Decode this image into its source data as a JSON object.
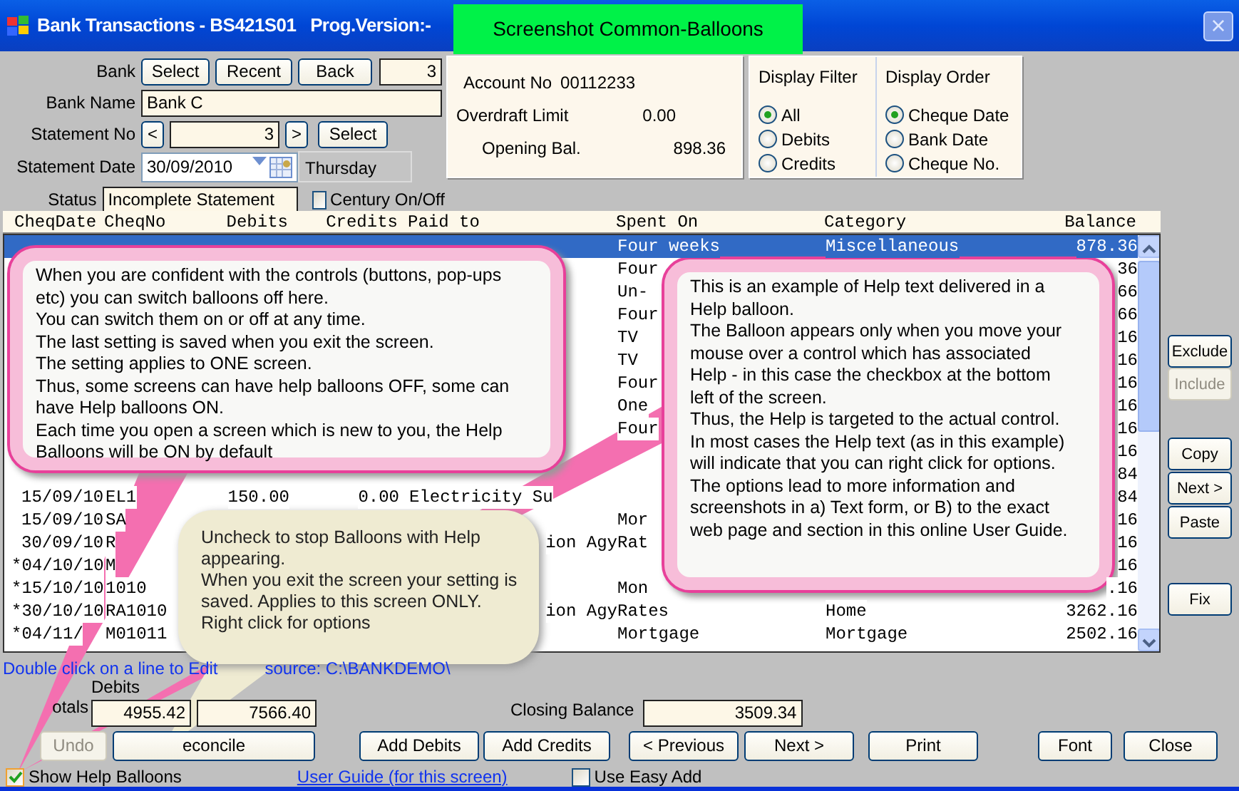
{
  "window": {
    "title": "Bank Transactions - BS421S01   Prog.Version:-",
    "close": "×"
  },
  "screenshot_label": "Screenshot Common-Balloons",
  "bank": {
    "label": "Bank",
    "buttons": [
      "Select",
      "Recent",
      "Back"
    ],
    "value": "3"
  },
  "bank_name": {
    "label": "Bank Name",
    "value": "Bank C"
  },
  "statement_no": {
    "label": "Statement No",
    "prev": "<",
    "value": "3",
    "next": ">",
    "button": "Select"
  },
  "statement_date": {
    "label": "Statement Date",
    "value": "30/09/2010",
    "weekday": "Thursday"
  },
  "status": {
    "label": "Status",
    "value": "Incomplete Statement"
  },
  "century": {
    "label": "Century On/Off",
    "checked": false
  },
  "account": [
    {
      "label": "Account No",
      "value": "00112233"
    },
    {
      "label": "Overdraft Limit",
      "value": "0.00"
    },
    {
      "label": "Opening Bal.",
      "value": "898.36"
    }
  ],
  "display_filter": {
    "title": "Display Filter",
    "options": [
      {
        "label": "All",
        "selected": true
      },
      {
        "label": "Debits",
        "selected": false
      },
      {
        "label": "Credits",
        "selected": false
      }
    ]
  },
  "display_order": {
    "title": "Display Order",
    "options": [
      {
        "label": "Cheque Date",
        "selected": true
      },
      {
        "label": "Bank Date",
        "selected": false
      },
      {
        "label": "Cheque No.",
        "selected": false
      }
    ]
  },
  "table": {
    "columns": [
      "CheqDate",
      "CheqNo",
      "Debits",
      "Credits",
      "Paid to",
      "Spent On",
      "Category",
      "Balance"
    ],
    "rows": [
      {
        "selected": true,
        "spent_on": "Four weeks",
        "category": "Miscellaneous",
        "balance": "878.36"
      },
      {
        "selected": false,
        "spent_on": "Four",
        "balance": "36"
      },
      {
        "selected": false,
        "spent_on": "Un-",
        "balance": "66"
      },
      {
        "selected": false,
        "spent_on": "Four",
        "balance": "66"
      },
      {
        "selected": false,
        "spent_on": "TV",
        "balance": "16"
      },
      {
        "selected": false,
        "spent_on": "TV",
        "balance": "16"
      },
      {
        "selected": false,
        "spent_on": "Four",
        "balance": "16"
      },
      {
        "selected": false,
        "spent_on": "One",
        "balance": "16"
      },
      {
        "selected": false,
        "spent_on": "Four",
        "balance": "16"
      },
      {
        "selected": false,
        "balance": "16"
      },
      {
        "selected": false,
        "balance": "84"
      },
      {
        "selected": false,
        "date": "15/09/10",
        "cheque": "EL1",
        "debits": "150.00",
        "credits": "0.00",
        "paid_to": "Electricity Su",
        "balance": "84"
      },
      {
        "selected": false,
        "date": "15/09/10",
        "cheque": "SA",
        "spent_on": "Mor",
        "balance": "16"
      },
      {
        "selected": false,
        "date": "30/09/10",
        "cheque": "R",
        "paid_to": "ion Agy",
        "paid_to_cut": true,
        "spent_on": "Rat",
        "balance": "16"
      },
      {
        "selected": false,
        "date": "*04/10/10",
        "cheque": "M",
        "balance": "16"
      },
      {
        "selected": false,
        "date": "*15/10/10",
        "cheque": "1010",
        "spent_on": "Mon",
        "balance": ".16"
      },
      {
        "selected": false,
        "date": "*30/10/10",
        "cheque": "RA1010",
        "paid_to": "ion Agy",
        "paid_to_cut": true,
        "spent_on": "Rates",
        "category": "Home",
        "balance": "3262.16"
      },
      {
        "selected": false,
        "date": "*04/11/",
        "cheque": "M01011",
        "spent_on": "Mortgage",
        "category": "Mortgage",
        "balance": "2502.16"
      }
    ]
  },
  "side_buttons": [
    {
      "label": "Exclude",
      "disabled": false
    },
    {
      "label": "Include",
      "disabled": true
    },
    {
      "label": "Copy",
      "disabled": false
    },
    {
      "label": "Next >",
      "disabled": false
    },
    {
      "label": "Paste",
      "disabled": false
    },
    {
      "label": "Fix",
      "disabled": false
    }
  ],
  "hints": [
    "Double click on a line to Edit",
    "source: C:\\BANKDEMO\\"
  ],
  "totals": {
    "label": "otals",
    "debits_label": "Debits",
    "debits": "4955.42",
    "credits": "7566.40",
    "closing_label": "Closing Balance",
    "closing": "3509.34"
  },
  "buttons": [
    {
      "label": "Undo",
      "disabled": true
    },
    {
      "label": "econcile",
      "disabled": false
    },
    {
      "label": "Add Debits",
      "disabled": false
    },
    {
      "label": "Add Credits",
      "disabled": false
    },
    {
      "label": "< Previous",
      "disabled": false
    },
    {
      "label": "Next >",
      "disabled": false
    },
    {
      "label": "Print",
      "disabled": false
    },
    {
      "label": "Font",
      "disabled": false
    },
    {
      "label": "Close",
      "disabled": false
    }
  ],
  "show_help": {
    "label": "Show Help Balloons",
    "checked": true
  },
  "user_guide_link": "User Guide (for this screen)",
  "easy_add": {
    "label": "Use Easy Add",
    "checked": false
  },
  "balloons": [
    {
      "kind": "help",
      "lines": [
        "When you are confident with the controls (buttons, pop-ups etc) you can switch balloons off here.",
        "You can switch them on or off at any time.",
        "The last setting is saved when you exit the screen.",
        "The setting applies to ONE screen.",
        "Thus, some screens can have help balloons OFF, some can have Help balloons ON.",
        "Each time you open a screen which is new to you, the Help Balloons will be ON by default"
      ]
    },
    {
      "kind": "help",
      "lines": [
        "This is an example of Help text delivered in a Help balloon.",
        "The Balloon appears only when you move your mouse over a control which has associated Help - in this case the checkbox at the bottom left of the screen.",
        "Thus, the Help is targeted to the actual control.",
        "In most cases the Help text (as in this example) will indicate that you can right click for options.",
        "The options lead to more information and screenshots in a) Text form, or B) to the exact web page and section in this online User Guide."
      ]
    },
    {
      "kind": "tip",
      "lines": [
        "Uncheck to stop Balloons with Help appearing.",
        "When you exit the screen your setting is saved. Applies to this screen ONLY.",
        "Right click for options"
      ]
    }
  ]
}
